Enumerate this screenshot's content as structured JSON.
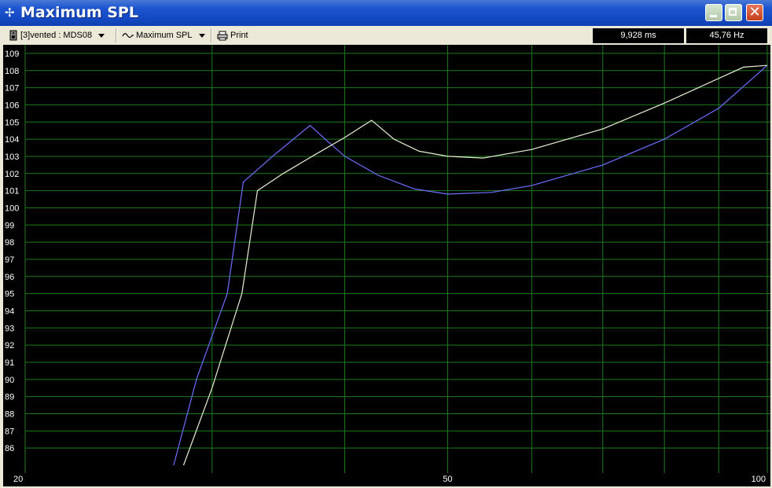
{
  "window": {
    "title": "Maximum SPL",
    "icon": "pin-icon"
  },
  "toolbar": {
    "project_select": "[3]vented : MDS08",
    "view_select": "Maximum SPL",
    "print_label": "Print",
    "time_readout": "9,928 ms",
    "freq_readout": "45,76 Hz"
  },
  "colors": {
    "background": "#000000",
    "grid": "#1f7a1f",
    "series1": "#6f6fff",
    "series2": "#e8f0d0"
  },
  "chart_data": {
    "type": "line",
    "title": "",
    "xlabel": "",
    "ylabel": "",
    "xscale": "log",
    "xlim": [
      20,
      100
    ],
    "ylim": [
      85,
      109.5
    ],
    "x_tick_labels": [
      "20",
      "50",
      "100"
    ],
    "x_gridlines": [
      30,
      40,
      50,
      60,
      70,
      80,
      90
    ],
    "y_ticks": [
      86,
      87,
      88,
      89,
      90,
      91,
      92,
      93,
      94,
      95,
      96,
      97,
      98,
      99,
      100,
      101,
      102,
      103,
      104,
      105,
      106,
      107,
      108,
      109
    ],
    "grid": true,
    "series": [
      {
        "points": [
          [
            27.6,
            85
          ],
          [
            29.0,
            90
          ],
          [
            31.0,
            95
          ],
          [
            32.1,
            101.5
          ],
          [
            34.2,
            103
          ],
          [
            37.1,
            104.8
          ],
          [
            38.5,
            103.9
          ],
          [
            40.0,
            103
          ],
          [
            43.0,
            101.9
          ],
          [
            46.5,
            101.1
          ],
          [
            50.0,
            100.8
          ],
          [
            55.0,
            100.9
          ],
          [
            60.0,
            101.3
          ],
          [
            70.0,
            102.5
          ],
          [
            80.0,
            104
          ],
          [
            90.0,
            105.8
          ],
          [
            100.0,
            108.3
          ]
        ]
      },
      {
        "points": [
          [
            28.2,
            85
          ],
          [
            30.0,
            89.5
          ],
          [
            32.0,
            95
          ],
          [
            33.1,
            101
          ],
          [
            35.0,
            102
          ],
          [
            37.5,
            103.1
          ],
          [
            40.0,
            104.1
          ],
          [
            42.4,
            105.1
          ],
          [
            44.5,
            104
          ],
          [
            47.0,
            103.3
          ],
          [
            50.0,
            103
          ],
          [
            54.0,
            102.9
          ],
          [
            60.0,
            103.4
          ],
          [
            70.0,
            104.6
          ],
          [
            80.0,
            106.1
          ],
          [
            95.0,
            108.2
          ],
          [
            100.0,
            108.3
          ]
        ]
      }
    ]
  }
}
